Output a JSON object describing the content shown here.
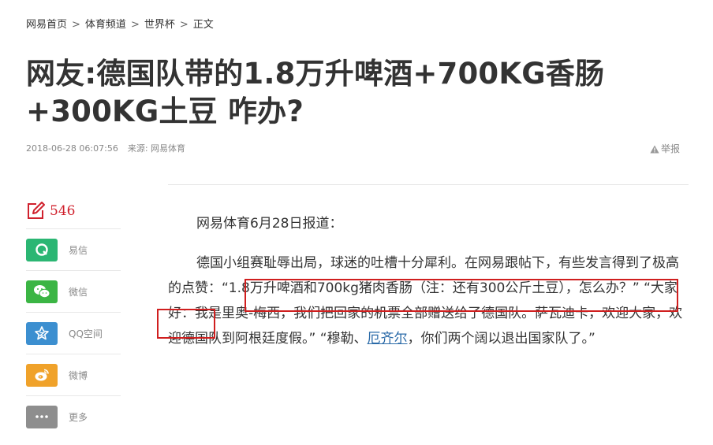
{
  "breadcrumb": {
    "items": [
      "网易首页",
      "体育频道",
      "世界杯",
      "正文"
    ],
    "separator": ">"
  },
  "article": {
    "title": "网友:德国队带的1.8万升啤酒+700KG香肠+300KG土豆 咋办?",
    "datetime": "2018-06-28 06:07:56",
    "source": "来源: 网易体育",
    "report_label": "举报",
    "para1": "网易体育6月28日报道：",
    "para2_before_link": "德国小组赛耻辱出局，球迷的吐槽十分犀利。在网易跟帖下，有些发言得到了极高的点赞：“1.8万升啤酒和700kg猪肉香肠（注：还有300公斤土豆），怎么办？” “大家好：我是里奥-梅西，我们把回家的机票全部赠送给了德国队。萨瓦迪卡，欢迎大家，欢迎德国队到阿根廷度假。” “穆勒、",
    "para2_link": "厄齐尔",
    "para2_after_link": "，你们两个阔以退出国家队了。”"
  },
  "share": {
    "comment_count": "546",
    "items": [
      {
        "label": "易信",
        "icon": "yixin-icon",
        "color": "#2bb673"
      },
      {
        "label": "微信",
        "icon": "wechat-icon",
        "color": "#3bb544"
      },
      {
        "label": "QQ空间",
        "icon": "qzone-icon",
        "color": "#3c8fd0"
      },
      {
        "label": "微博",
        "icon": "weibo-icon",
        "color": "#f0a22a"
      },
      {
        "label": "更多",
        "icon": "more-icon",
        "color": "#8e8e8e"
      }
    ]
  },
  "colors": {
    "accent": "#d0212d",
    "highlight_box": "#d01f1f",
    "link": "#2a6aa8"
  }
}
